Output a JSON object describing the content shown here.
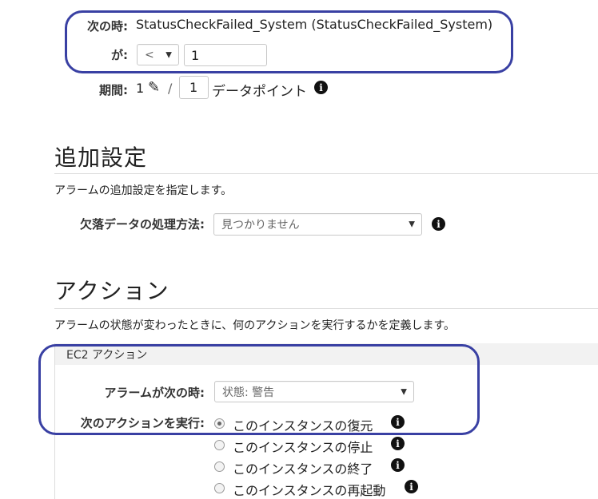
{
  "condition": {
    "when_label": "次の時:",
    "metric_text": "StatusCheckFailed_System (StatusCheckFailed_System)",
    "is_label": "が:",
    "operator_value": "<",
    "threshold_value": "1",
    "period_label": "期間:",
    "period_value": "1",
    "slash": "/",
    "datapoints_value": "1",
    "datapoints_suffix": "データポイント"
  },
  "additional": {
    "heading": "追加設定",
    "description": "アラームの追加設定を指定します。",
    "missing_label": "欠落データの処理方法:",
    "missing_value": "見つかりません"
  },
  "actions": {
    "heading": "アクション",
    "description": "アラームの状態が変わったときに、何のアクションを実行するかを定義します。",
    "ec2_panel_title": "EC2 アクション",
    "when_alarm_label": "アラームが次の時:",
    "state_value": "状態: 警告",
    "do_action_label": "次のアクションを実行:",
    "options": [
      {
        "label": "このインスタンスの復元",
        "checked": true
      },
      {
        "label": "このインスタンスの停止",
        "checked": false
      },
      {
        "label": "このインスタンスの終了",
        "checked": false
      },
      {
        "label": "このインスタンスの再起動",
        "checked": false
      }
    ]
  },
  "icons": {
    "info": "i",
    "pencil": "✎",
    "dropdown": "▼"
  },
  "colors": {
    "highlight": "#3940a3"
  }
}
